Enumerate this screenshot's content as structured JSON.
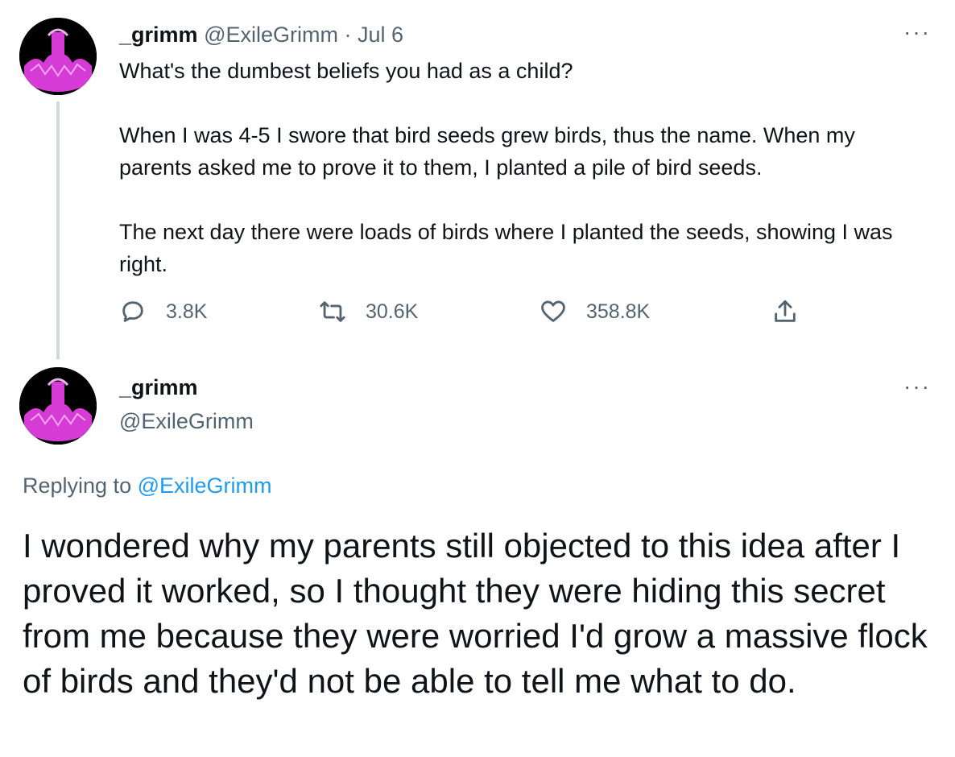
{
  "tweet": {
    "author_name": "_grimm",
    "author_handle": "@ExileGrimm",
    "separator": "·",
    "date": "Jul 6",
    "more_label": "···",
    "paragraphs": [
      "What's the dumbest beliefs you had as a child?",
      "When I was 4-5 I swore that bird seeds grew birds, thus the name. When my parents asked me to prove it to them, I planted a pile of bird seeds.",
      "The next day there were loads of birds where I planted the seeds, showing I was right."
    ],
    "actions": {
      "reply_count": "3.8K",
      "retweet_count": "30.6K",
      "like_count": "358.8K"
    }
  },
  "reply": {
    "author_name": "_grimm",
    "author_handle": "@ExileGrimm",
    "more_label": "···",
    "replying_prefix": "Replying to",
    "replying_handle": "@ExileGrimm",
    "text": "I wondered why my parents still objected to this idea after I proved it worked, so I thought they were hiding this secret from me because they were worried I'd grow a massive flock of birds and they'd not be able to tell me what to do."
  },
  "colors": {
    "text": "#0f1419",
    "muted": "#536471",
    "link": "#1d9bf0",
    "thread_line": "#cfd9de",
    "avatar_accent": "#d63bd6"
  },
  "icons": [
    "avatar",
    "reply-icon",
    "retweet-icon",
    "like-icon",
    "share-icon",
    "more-icon"
  ]
}
